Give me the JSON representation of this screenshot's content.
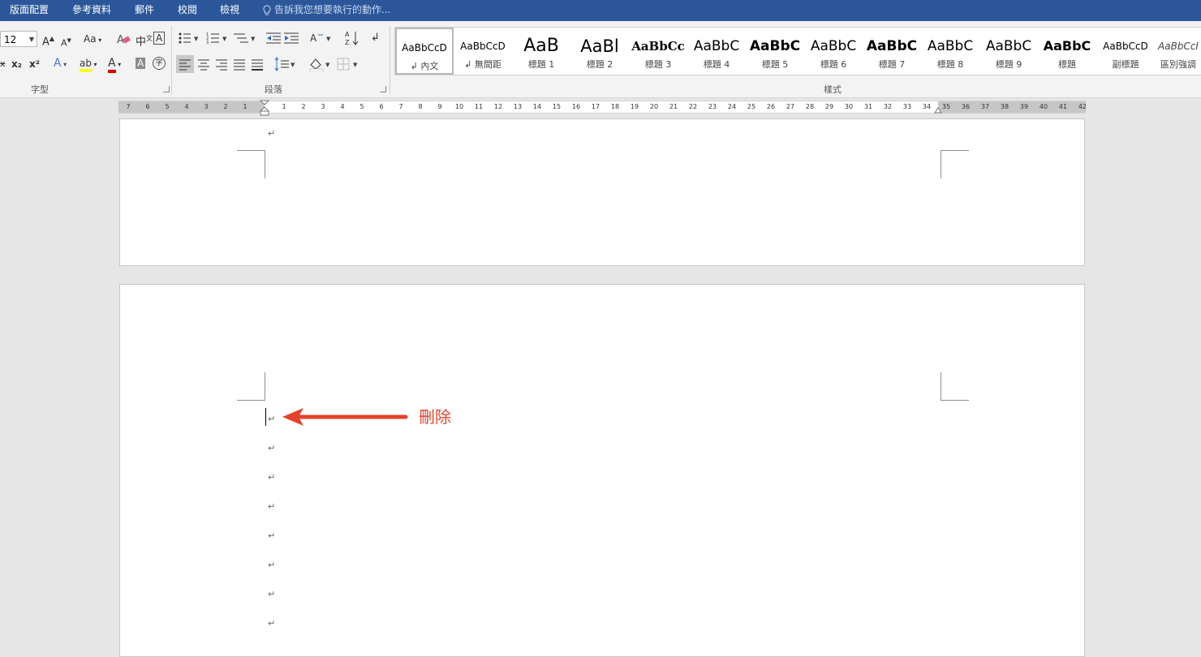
{
  "tabs": [
    "版面配置",
    "參考資料",
    "郵件",
    "校閱",
    "檢視"
  ],
  "tell_me": "告訴我您想要執行的動作...",
  "font_group": {
    "size": "12",
    "grow_label": "A",
    "shrink_label": "A",
    "case_label": "Aa",
    "phonetic_label": "中",
    "border_label": "A",
    "strike_label": "x",
    "sub_label": "x₂",
    "sup_label": "x²",
    "text_effect_label": "A",
    "highlight_label": "ab",
    "font_color_label": "A",
    "char_shade_label": "A",
    "enclose_label": "字",
    "label": "字型"
  },
  "paragraph_group": {
    "label": "段落"
  },
  "styles_group": {
    "label": "樣式",
    "items": [
      {
        "preview": "AaBbCcD",
        "name": "內文",
        "mark": "↲"
      },
      {
        "preview": "AaBbCcD",
        "name": "無間距",
        "mark": "↲"
      },
      {
        "preview": "AaB",
        "name": "標題 1",
        "mark": ""
      },
      {
        "preview": "AaBl",
        "name": "標題 2",
        "mark": ""
      },
      {
        "preview": "AaBbCc",
        "name": "標題 3",
        "mark": ""
      },
      {
        "preview": "AaBbC",
        "name": "標題 4",
        "mark": ""
      },
      {
        "preview": "AaBbC",
        "name": "標題 5",
        "mark": ""
      },
      {
        "preview": "AaBbC",
        "name": "標題 6",
        "mark": ""
      },
      {
        "preview": "AaBbC",
        "name": "標題 7",
        "mark": ""
      },
      {
        "preview": "AaBbC",
        "name": "標題 8",
        "mark": ""
      },
      {
        "preview": "AaBbC",
        "name": "標題 9",
        "mark": ""
      },
      {
        "preview": "AaBbC",
        "name": "標題",
        "mark": ""
      },
      {
        "preview": "AaBbCcD",
        "name": "副標題",
        "mark": ""
      },
      {
        "preview": "AaBbCcI",
        "name": "區別強調",
        "mark": ""
      }
    ]
  },
  "ruler": {
    "left_ticks": [
      "7",
      "6",
      "5",
      "4",
      "3",
      "2",
      "1"
    ],
    "right_ticks": [
      "1",
      "2",
      "3",
      "4",
      "5",
      "6",
      "7",
      "8",
      "9",
      "10",
      "11",
      "12",
      "13",
      "14",
      "15",
      "16",
      "17",
      "18",
      "19",
      "20",
      "21",
      "22",
      "23",
      "24",
      "25",
      "26",
      "27",
      "28",
      "29",
      "30",
      "31",
      "32",
      "33",
      "34",
      "35",
      "36",
      "37",
      "38",
      "39",
      "40",
      "41",
      "42"
    ]
  },
  "document": {
    "paragraph_mark": "↵",
    "annotation": "刪除",
    "accent_color": "#e2432a"
  },
  "colors": {
    "ribbon_tab_bar": "#2b579a",
    "ribbon_body": "#f3f3f3",
    "workspace": "#e6e6e6"
  }
}
